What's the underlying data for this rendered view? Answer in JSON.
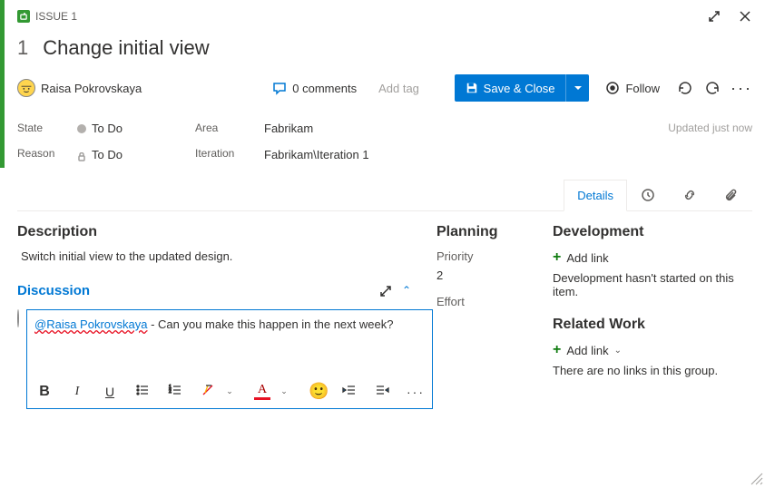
{
  "header": {
    "type_label": "ISSUE 1",
    "id": "1",
    "title": "Change initial view"
  },
  "assignee": {
    "name": "Raisa Pokrovskaya"
  },
  "comments": {
    "label": "0 comments"
  },
  "addtag": "Add tag",
  "actions": {
    "save": "Save & Close",
    "follow": "Follow"
  },
  "fields": {
    "labels": {
      "state": "State",
      "reason": "Reason",
      "area": "Area",
      "iteration": "Iteration"
    },
    "state": "To Do",
    "reason": "To Do",
    "area": "Fabrikam",
    "iteration": "Fabrikam\\Iteration 1"
  },
  "updated": "Updated just now",
  "tabs": {
    "details": "Details"
  },
  "description": {
    "heading": "Description",
    "text": "Switch initial view to the updated design."
  },
  "discussion": {
    "heading": "Discussion",
    "mention": "@Raisa Pokrovskaya",
    "text": " - Can you make this happen in the next week?"
  },
  "planning": {
    "heading": "Planning",
    "priority_label": "Priority",
    "priority": "2",
    "effort_label": "Effort"
  },
  "development": {
    "heading": "Development",
    "addlink": "Add link",
    "note": "Development hasn't started on this item."
  },
  "related": {
    "heading": "Related Work",
    "addlink": "Add link",
    "note": "There are no links in this group."
  }
}
